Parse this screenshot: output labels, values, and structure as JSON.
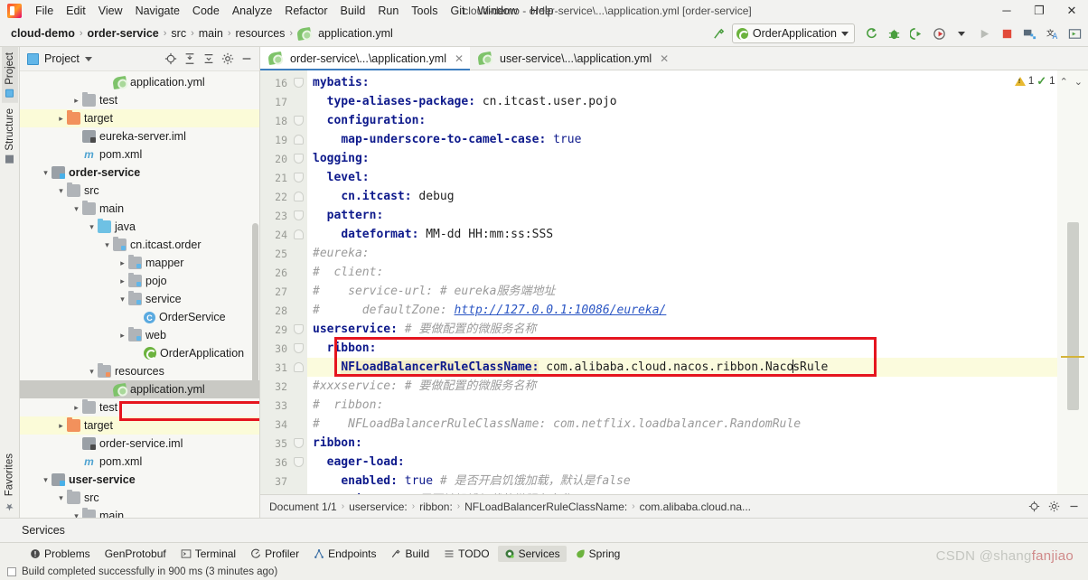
{
  "window": {
    "title": "cloud-demo - order-service\\...\\application.yml [order-service]",
    "minimize": "─",
    "maximize": "❐",
    "close": "✕"
  },
  "menu": {
    "items": [
      "File",
      "Edit",
      "View",
      "Navigate",
      "Code",
      "Analyze",
      "Refactor",
      "Build",
      "Run",
      "Tools",
      "Git",
      "Window",
      "Help"
    ]
  },
  "navbar": {
    "breadcrumbs": [
      {
        "label": "cloud-demo",
        "bold": true,
        "icon": ""
      },
      {
        "label": "order-service",
        "bold": true,
        "icon": ""
      },
      {
        "label": "src",
        "bold": false,
        "icon": ""
      },
      {
        "label": "main",
        "bold": false,
        "icon": ""
      },
      {
        "label": "resources",
        "bold": false,
        "icon": ""
      },
      {
        "label": "application.yml",
        "bold": false,
        "icon": "yml-icon"
      }
    ],
    "separator": "›",
    "run_config": "OrderApplication",
    "icons": [
      "build-hammer-icon",
      "rerun-icon",
      "debug-bug-icon",
      "run-with-coverage-icon",
      "profile-icon",
      "run-icon",
      "stop-icon",
      "project-structure-icon",
      "translate-icon",
      "terminal-icon"
    ]
  },
  "sidebar_tabs": {
    "left_top": [
      "Project",
      "Structure"
    ],
    "left_bottom": [
      "Favorites"
    ]
  },
  "project_panel": {
    "title": "Project",
    "tools": [
      "locate-icon",
      "expand-all-icon",
      "collapse-all-icon",
      "settings-gear-icon",
      "hide-icon"
    ],
    "tree": [
      {
        "label": "application.yml",
        "indent": 6,
        "arrow": "none",
        "icon": "yml-icon",
        "highlight": "none",
        "bold": false
      },
      {
        "label": "test",
        "indent": 4,
        "arrow": "collapsed",
        "icon": "folder-gray",
        "highlight": "none",
        "bold": false
      },
      {
        "label": "target",
        "indent": 3,
        "arrow": "collapsed",
        "icon": "folder-orange",
        "highlight": "yellow",
        "bold": false
      },
      {
        "label": "eureka-server.iml",
        "indent": 4,
        "arrow": "none",
        "icon": "iml-icon",
        "highlight": "none",
        "bold": false
      },
      {
        "label": "pom.xml",
        "indent": 4,
        "arrow": "none",
        "icon": "maven-icon",
        "highlight": "none",
        "bold": false
      },
      {
        "label": "order-service",
        "indent": 2,
        "arrow": "expanded",
        "icon": "module-icon",
        "highlight": "none",
        "bold": true
      },
      {
        "label": "src",
        "indent": 3,
        "arrow": "expanded",
        "icon": "folder-gray",
        "highlight": "none",
        "bold": false
      },
      {
        "label": "main",
        "indent": 4,
        "arrow": "expanded",
        "icon": "folder-gray",
        "highlight": "none",
        "bold": false
      },
      {
        "label": "java",
        "indent": 5,
        "arrow": "expanded",
        "icon": "folder-blue",
        "highlight": "none",
        "bold": false
      },
      {
        "label": "cn.itcast.order",
        "indent": 6,
        "arrow": "expanded",
        "icon": "package-icon",
        "highlight": "none",
        "bold": false
      },
      {
        "label": "mapper",
        "indent": 7,
        "arrow": "collapsed",
        "icon": "package-icon",
        "highlight": "none",
        "bold": false
      },
      {
        "label": "pojo",
        "indent": 7,
        "arrow": "collapsed",
        "icon": "package-icon",
        "highlight": "none",
        "bold": false
      },
      {
        "label": "service",
        "indent": 7,
        "arrow": "expanded",
        "icon": "package-icon",
        "highlight": "none",
        "bold": false
      },
      {
        "label": "OrderService",
        "indent": 8,
        "arrow": "none",
        "icon": "class-icon",
        "highlight": "none",
        "bold": false
      },
      {
        "label": "web",
        "indent": 7,
        "arrow": "collapsed",
        "icon": "package-icon",
        "highlight": "none",
        "bold": false
      },
      {
        "label": "OrderApplication",
        "indent": 8,
        "arrow": "none",
        "icon": "springboot-icon",
        "highlight": "none",
        "bold": false
      },
      {
        "label": "resources",
        "indent": 5,
        "arrow": "expanded",
        "icon": "resources-folder-icon",
        "highlight": "none",
        "bold": false
      },
      {
        "label": "application.yml",
        "indent": 6,
        "arrow": "none",
        "icon": "yml-icon",
        "highlight": "selected",
        "bold": false
      },
      {
        "label": "test",
        "indent": 4,
        "arrow": "collapsed",
        "icon": "folder-gray",
        "highlight": "none",
        "bold": false
      },
      {
        "label": "target",
        "indent": 3,
        "arrow": "collapsed",
        "icon": "folder-orange",
        "highlight": "yellow",
        "bold": false
      },
      {
        "label": "order-service.iml",
        "indent": 4,
        "arrow": "none",
        "icon": "iml-icon",
        "highlight": "none",
        "bold": false
      },
      {
        "label": "pom.xml",
        "indent": 4,
        "arrow": "none",
        "icon": "maven-icon",
        "highlight": "none",
        "bold": false
      },
      {
        "label": "user-service",
        "indent": 2,
        "arrow": "expanded",
        "icon": "module-icon",
        "highlight": "none",
        "bold": true
      },
      {
        "label": "src",
        "indent": 3,
        "arrow": "expanded",
        "icon": "folder-gray",
        "highlight": "none",
        "bold": false
      },
      {
        "label": "main",
        "indent": 4,
        "arrow": "expanded",
        "icon": "folder-gray",
        "highlight": "none",
        "bold": false
      }
    ]
  },
  "editor": {
    "tabs": [
      {
        "label": "order-service\\...\\application.yml",
        "active": true,
        "icon": "yml-icon",
        "close": "✕"
      },
      {
        "label": "user-service\\...\\application.yml",
        "active": false,
        "icon": "yml-icon",
        "close": "✕"
      }
    ],
    "first_line_number": 16,
    "inspection": {
      "warning_count": "1",
      "ok_count": "1",
      "up": "⌃",
      "down": "⌄"
    },
    "lines": [
      {
        "n": 16,
        "indent": 1,
        "segs": [
          {
            "t": "mybatis:",
            "c": "key"
          }
        ],
        "fold": "open",
        "hl": false
      },
      {
        "n": 17,
        "indent": 2,
        "segs": [
          {
            "t": "type-aliases-package:",
            "c": "key"
          },
          {
            "t": " cn.itcast.user.pojo",
            "c": "val"
          }
        ],
        "fold": "",
        "hl": false
      },
      {
        "n": 18,
        "indent": 2,
        "segs": [
          {
            "t": "configuration:",
            "c": "key"
          }
        ],
        "fold": "open",
        "hl": false
      },
      {
        "n": 19,
        "indent": 3,
        "segs": [
          {
            "t": "map-underscore-to-camel-case:",
            "c": "key"
          },
          {
            "t": " true",
            "c": "bool"
          }
        ],
        "fold": "close",
        "hl": false
      },
      {
        "n": 20,
        "indent": 1,
        "segs": [
          {
            "t": "logging:",
            "c": "key"
          }
        ],
        "fold": "open",
        "hl": false
      },
      {
        "n": 21,
        "indent": 2,
        "segs": [
          {
            "t": "level:",
            "c": "key"
          }
        ],
        "fold": "open",
        "hl": false
      },
      {
        "n": 22,
        "indent": 3,
        "segs": [
          {
            "t": "cn.itcast:",
            "c": "key"
          },
          {
            "t": " debug",
            "c": "val"
          }
        ],
        "fold": "close",
        "hl": false
      },
      {
        "n": 23,
        "indent": 2,
        "segs": [
          {
            "t": "pattern:",
            "c": "key"
          }
        ],
        "fold": "open",
        "hl": false
      },
      {
        "n": 24,
        "indent": 3,
        "segs": [
          {
            "t": "dateformat:",
            "c": "key"
          },
          {
            "t": " MM-dd HH:mm:ss:SSS",
            "c": "val"
          }
        ],
        "fold": "close",
        "hl": false
      },
      {
        "n": 25,
        "indent": 1,
        "segs": [
          {
            "t": "#eureka:",
            "c": "cmt"
          }
        ],
        "fold": "",
        "hl": false
      },
      {
        "n": 26,
        "indent": 1,
        "segs": [
          {
            "t": "#  client:",
            "c": "cmt"
          }
        ],
        "fold": "",
        "hl": false
      },
      {
        "n": 27,
        "indent": 1,
        "segs": [
          {
            "t": "#    service-url: # eureka服务端地址",
            "c": "cmt"
          }
        ],
        "fold": "",
        "hl": false
      },
      {
        "n": 28,
        "indent": 1,
        "segs": [
          {
            "t": "#      defaultZone: ",
            "c": "cmt"
          },
          {
            "t": "http://127.0.0.1:10086/eureka/",
            "c": "link"
          }
        ],
        "fold": "",
        "hl": false
      },
      {
        "n": 29,
        "indent": 1,
        "segs": [
          {
            "t": "userservice:",
            "c": "key"
          },
          {
            "t": " # ",
            "c": "cmt"
          },
          {
            "t": "要做配置的微服务名称",
            "c": "cmt"
          }
        ],
        "fold": "open",
        "hl": false
      },
      {
        "n": 30,
        "indent": 2,
        "segs": [
          {
            "t": "ribbon:",
            "c": "key"
          }
        ],
        "fold": "open",
        "hl": false
      },
      {
        "n": 31,
        "indent": 3,
        "segs": [
          {
            "t": "NFLoadBalancerRuleClassName:",
            "c": "key-hl"
          },
          {
            "t": " com.alibaba.cloud.nacos.ribbon.Naco",
            "c": "val"
          },
          {
            "t": "|",
            "c": "caret"
          },
          {
            "t": "sRule",
            "c": "val"
          }
        ],
        "fold": "close",
        "hl": true
      },
      {
        "n": 32,
        "indent": 1,
        "segs": [
          {
            "t": "#xxxservice: # ",
            "c": "cmt"
          },
          {
            "t": "要做配置的微服务名称",
            "c": "cmt"
          }
        ],
        "fold": "",
        "hl": false
      },
      {
        "n": 33,
        "indent": 1,
        "segs": [
          {
            "t": "#  ribbon:",
            "c": "cmt"
          }
        ],
        "fold": "",
        "hl": false
      },
      {
        "n": 34,
        "indent": 1,
        "segs": [
          {
            "t": "#    NFLoadBalancerRuleClassName: com.netflix.loadbalancer.RandomRule",
            "c": "cmt"
          }
        ],
        "fold": "",
        "hl": false
      },
      {
        "n": 35,
        "indent": 1,
        "segs": [
          {
            "t": "ribbon:",
            "c": "key"
          }
        ],
        "fold": "open",
        "hl": false
      },
      {
        "n": 36,
        "indent": 2,
        "segs": [
          {
            "t": "eager-load:",
            "c": "key"
          }
        ],
        "fold": "open",
        "hl": false
      },
      {
        "n": 37,
        "indent": 3,
        "segs": [
          {
            "t": "enabled:",
            "c": "key"
          },
          {
            "t": " true",
            "c": "bool"
          },
          {
            "t": " # ",
            "c": "cmt"
          },
          {
            "t": "是否开启饥饿加载，默认是false",
            "c": "cmt"
          }
        ],
        "fold": "",
        "hl": false
      },
      {
        "n": 38,
        "indent": 3,
        "segs": [
          {
            "t": "clients:",
            "c": "key"
          },
          {
            "t": " # ",
            "c": "cmt"
          },
          {
            "t": "需要被饥饿加载的微服务名称",
            "c": "cmt"
          }
        ],
        "fold": "close",
        "hl": false
      }
    ],
    "doc_breadcrumb": [
      "Document 1/1",
      "userservice:",
      "ribbon:",
      "NFLoadBalancerRuleClassName:",
      "com.alibaba.cloud.na..."
    ],
    "doc_breadcrumb_sep": "›",
    "doc_breadcrumb_tools": [
      "locate-icon",
      "settings-gear-icon",
      "hide-icon"
    ]
  },
  "services": {
    "title": "Services"
  },
  "bottom_bar": {
    "tabs": [
      {
        "label": "Problems",
        "icon": "problems-icon",
        "active": false
      },
      {
        "label": "GenProtobuf",
        "icon": "",
        "active": false
      },
      {
        "label": "Terminal",
        "icon": "terminal-icon",
        "active": false
      },
      {
        "label": "Profiler",
        "icon": "profiler-icon",
        "active": false
      },
      {
        "label": "Endpoints",
        "icon": "endpoints-icon",
        "active": false
      },
      {
        "label": "Build",
        "icon": "build-hammer-icon",
        "active": false
      },
      {
        "label": "TODO",
        "icon": "todo-icon",
        "active": false
      },
      {
        "label": "Services",
        "icon": "services-icon",
        "active": true
      },
      {
        "label": "Spring",
        "icon": "spring-leaf-icon",
        "active": false
      }
    ]
  },
  "status_bar": {
    "message": "Build completed successfully in 900 ms (3 minutes ago)"
  },
  "watermark": {
    "text": "CSDN @shang",
    "suffix": "fanjiao"
  },
  "colors": {
    "accent_blue": "#3d7ebf",
    "highlight_red": "#e5151f",
    "selection_yellow": "#fbfbdd",
    "key_blue": "#0e1a8c",
    "comment_gray": "#9b9b9b",
    "link_blue": "#2b56c4",
    "spring_green": "#6cb33e"
  }
}
